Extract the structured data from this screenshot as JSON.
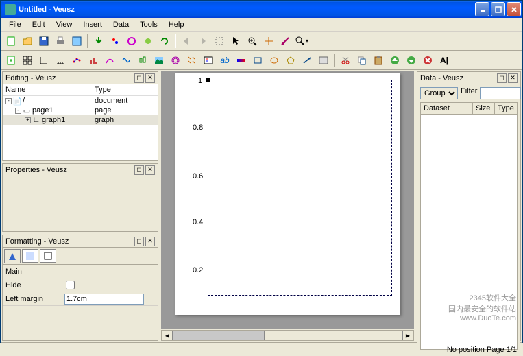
{
  "title": "Untitled - Veusz",
  "menu": {
    "file": "File",
    "edit": "Edit",
    "view": "View",
    "insert": "Insert",
    "data": "Data",
    "tools": "Tools",
    "help": "Help"
  },
  "panels": {
    "editing": "Editing - Veusz",
    "properties": "Properties - Veusz",
    "formatting": "Formatting - Veusz",
    "data": "Data - Veusz"
  },
  "editing": {
    "col_name": "Name",
    "col_type": "Type",
    "rows": [
      {
        "indent": 0,
        "toggle": "-",
        "name": "/",
        "type": "document"
      },
      {
        "indent": 1,
        "toggle": "-",
        "name": "page1",
        "type": "page"
      },
      {
        "indent": 2,
        "toggle": "+",
        "name": "graph1",
        "type": "graph"
      }
    ]
  },
  "formatting": {
    "main": "Main",
    "hide": "Hide",
    "left_margin": "Left margin",
    "left_margin_val": "1.7cm"
  },
  "data": {
    "group_label": "Group",
    "filter_label": "Filter",
    "col_dataset": "Dataset",
    "col_size": "Size",
    "col_type": "Type"
  },
  "status": "No position Page 1/1",
  "chart_data": {
    "type": "line",
    "series": [],
    "xlim": [
      0,
      1
    ],
    "ylim": [
      0,
      1
    ],
    "yticks": [
      0.2,
      0.4,
      0.6,
      0.8,
      1.0
    ],
    "title": "",
    "xlabel": "",
    "ylabel": ""
  },
  "watermark": {
    "line1": "2345软件大全",
    "line2": "国内最安全的软件站",
    "line3": "www.DuoTe.com"
  }
}
